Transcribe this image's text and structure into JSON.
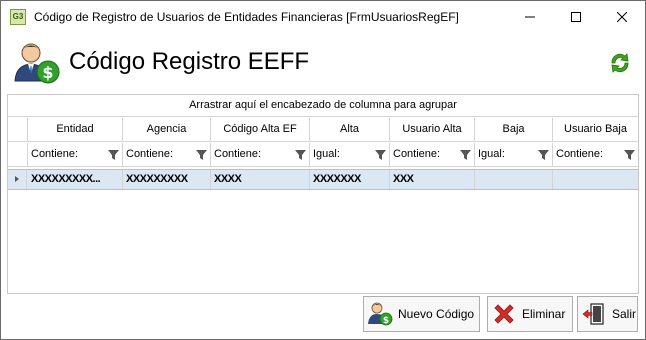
{
  "window": {
    "app_icon_text": "G3",
    "title": "Código de Registro de Usuarios de Entidades Financieras [FrmUsuariosRegEF]"
  },
  "header": {
    "title": "Código Registro EEFF"
  },
  "grid": {
    "group_panel_text": "Arrastrar aquí el encabezado de columna para agrupar",
    "columns": [
      "Entidad",
      "Agencia",
      "Código Alta EF",
      "Alta",
      "Usuario Alta",
      "Baja",
      "Usuario Baja"
    ],
    "filters": [
      "Contiene:",
      "Contiene:",
      "Contiene:",
      "Igual:",
      "Contiene:",
      "Igual:",
      "Contiene:"
    ],
    "rows": [
      [
        "XXXXXXXXX...",
        "XXXXXXXXX",
        "XXXX",
        "XXXXXXX",
        "XXX",
        "",
        ""
      ]
    ]
  },
  "buttons": {
    "new_label": "Nuevo Código",
    "delete_label": "Eliminar",
    "exit_label": "Salir"
  },
  "colors": {
    "selected_row": "#dbe8f4",
    "delete_icon": "#d42b2b",
    "refresh_icon": "#3ea51a"
  }
}
